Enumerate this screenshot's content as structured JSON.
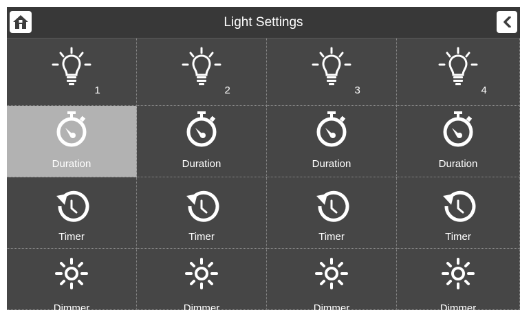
{
  "header": {
    "title": "Light Settings",
    "home_icon": "home-icon",
    "back_icon": "chevron-left-icon"
  },
  "colors": {
    "background": "#464646",
    "header": "#383838",
    "selected": "#b2b2b2",
    "icon": "#ffffff"
  },
  "lights": [
    {
      "number": "1",
      "duration_label": "Duration",
      "timer_label": "Timer",
      "dimmer_label": "Dimmer",
      "duration_selected": true
    },
    {
      "number": "2",
      "duration_label": "Duration",
      "timer_label": "Timer",
      "dimmer_label": "Dimmer",
      "duration_selected": false
    },
    {
      "number": "3",
      "duration_label": "Duration",
      "timer_label": "Timer",
      "dimmer_label": "Dimmer",
      "duration_selected": false
    },
    {
      "number": "4",
      "duration_label": "Duration",
      "timer_label": "Timer",
      "dimmer_label": "Dimmer",
      "duration_selected": false
    }
  ]
}
